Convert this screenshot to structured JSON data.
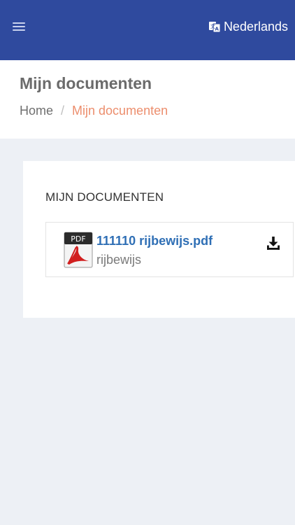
{
  "header": {
    "language_label": "Nederlands",
    "menu_icon": "hamburger-menu-icon",
    "language_icon": "translate-icon",
    "color": "#2f4a9e"
  },
  "page": {
    "title": "Mijn documenten",
    "breadcrumb": {
      "home": "Home",
      "separator": "/",
      "current": "Mijn documenten"
    }
  },
  "documents_card": {
    "title": "MIJN DOCUMENTEN",
    "items": [
      {
        "file_name": "111110 rijbewijs.pdf",
        "description": "rijbewijs",
        "file_icon": "pdf-file-icon",
        "action_icon": "download-icon"
      }
    ]
  },
  "colors": {
    "background": "#edf0f5",
    "link": "#2f6fb5",
    "breadcrumb_current": "#ec8e6d"
  }
}
